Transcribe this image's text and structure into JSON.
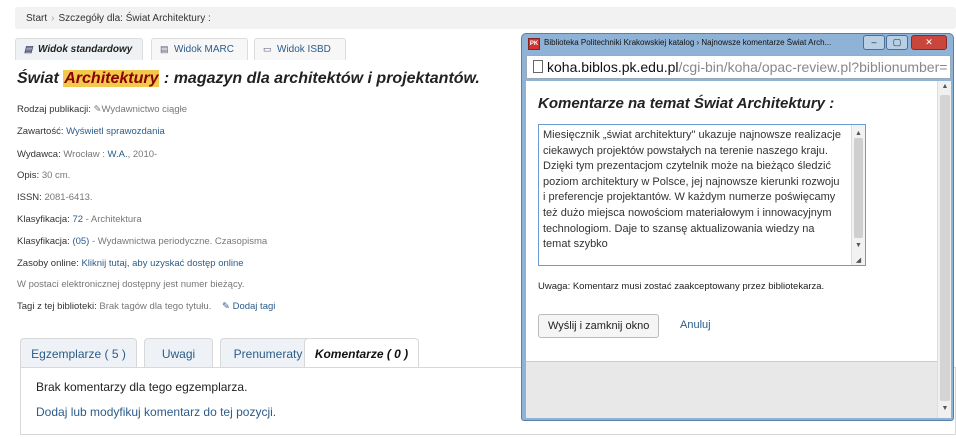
{
  "breadcrumb": {
    "home": "Start",
    "current": "Szczegóły dla: Świat Architektury :"
  },
  "view_tabs": [
    {
      "label": "Widok standardowy",
      "icon": "list-icon"
    },
    {
      "label": "Widok MARC",
      "icon": "list-icon"
    },
    {
      "label": "Widok ISBD",
      "icon": "book-icon"
    }
  ],
  "record": {
    "title_main": "Świat ",
    "title_highlight": "Architektury",
    "title_rest": " : magazyn dla architektów i projektantów.",
    "pub_type_label": "Rodzaj publikacji: ",
    "pub_type_value": "Wydawnictwo ciągłe",
    "contents_label": "Zawartość: ",
    "contents_link": "Wyświetl sprawozdania",
    "publisher_label": "Wydawca: ",
    "publisher_pre": "Wrocław : ",
    "publisher_link": "W.A.",
    "publisher_post": ", 2010-",
    "desc_label": "Opis: ",
    "desc_value": "30 cm.",
    "issn_label": "ISSN: ",
    "issn_value": "2081-6413.",
    "class1_label": "Klasyfikacja: ",
    "class1_link": "72",
    "class1_rest": " - Architektura",
    "class2_label": "Klasyfikacja: ",
    "class2_link": "(05)",
    "class2_rest": " - Wydawnictwa periodyczne. Czasopisma",
    "online_label": "Zasoby online: ",
    "online_link": "Kliknij tutaj, aby uzyskać dostęp online",
    "note": "W postaci elektronicznej dostępny jest numer bieżący.",
    "tags_label": "Tagi z tej biblioteki: ",
    "tags_value": "Brak tagów dla tego tytułu.",
    "add_tags": "Dodaj tagi"
  },
  "holdings_tabs": [
    {
      "label": "Egzemplarze ( 5 )"
    },
    {
      "label": "Uwagi"
    },
    {
      "label": "Prenumeraty"
    },
    {
      "label": "Komentarze ( 0 )"
    }
  ],
  "holdings_panel": {
    "no_comments": "Brak komentarzy dla tego egzemplarza.",
    "add_comment": "Dodaj lub modyfikuj komentarz do tej pozycji."
  },
  "popup": {
    "window_title": "Biblioteka Politechniki Krakowskiej katalog › Najnowsze komentarze Świat Arch...",
    "favicon_text": "PK",
    "url_domain": "koha.biblos.pk.edu.pl",
    "url_path": "/cgi-bin/koha/opac-review.pl?biblionumber=",
    "heading": "Komentarze na temat Świat Architektury :",
    "comment_text": "Miesięcznik „świat architektury\" ukazuje najnowsze realizacje ciekawych projektów powstałych na terenie naszego kraju. Dzięki tym prezentacjom czytelnik może na bieżąco śledzić poziom architektury w Polsce, jej najnowsze kierunki rozwoju i preferencje projektantów. W każdym numerze poświęcamy też dużo miejsca nowościom materiałowym i innowacyjnym technologiom. Daje to szansę aktualizowania wiedzy na temat szybko",
    "note": "Uwaga: Komentarz musi zostać zaakceptowany przez bibliotekarza.",
    "submit_label": "Wyślij i zamknij okno",
    "cancel_label": "Anuluj"
  }
}
